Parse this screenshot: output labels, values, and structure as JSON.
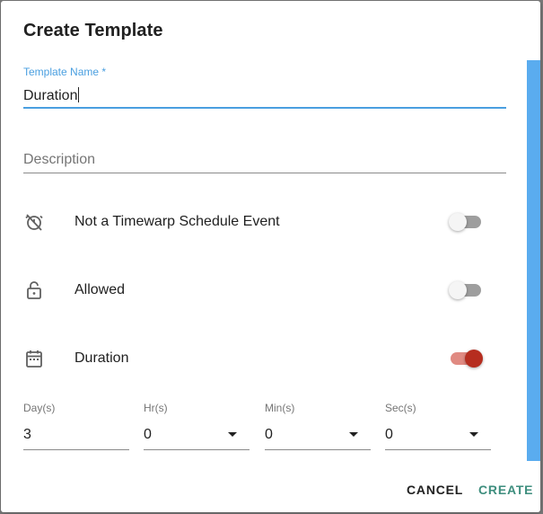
{
  "dialog": {
    "title": "Create Template"
  },
  "template_name": {
    "label": "Template Name *",
    "value": "Duration"
  },
  "description": {
    "label": "Description",
    "value": ""
  },
  "options": [
    {
      "label": "Not a Timewarp Schedule Event",
      "icon": "alarm-off-icon",
      "enabled": false
    },
    {
      "label": "Allowed",
      "icon": "lock-open-icon",
      "enabled": false
    },
    {
      "label": "Duration",
      "icon": "calendar-icon",
      "enabled": true
    }
  ],
  "duration": {
    "days": {
      "label": "Day(s)",
      "value": "3"
    },
    "hours": {
      "label": "Hr(s)",
      "value": "0"
    },
    "minutes": {
      "label": "Min(s)",
      "value": "0"
    },
    "seconds": {
      "label": "Sec(s)",
      "value": "0"
    }
  },
  "actions": {
    "cancel_label": "CANCEL",
    "create_label": "CREATE"
  },
  "colors": {
    "focus_accent": "#4a9fe0",
    "toggle_on": "#b62d1f",
    "create_button": "#3e8e7e",
    "scrollbar": "#5aacef"
  }
}
